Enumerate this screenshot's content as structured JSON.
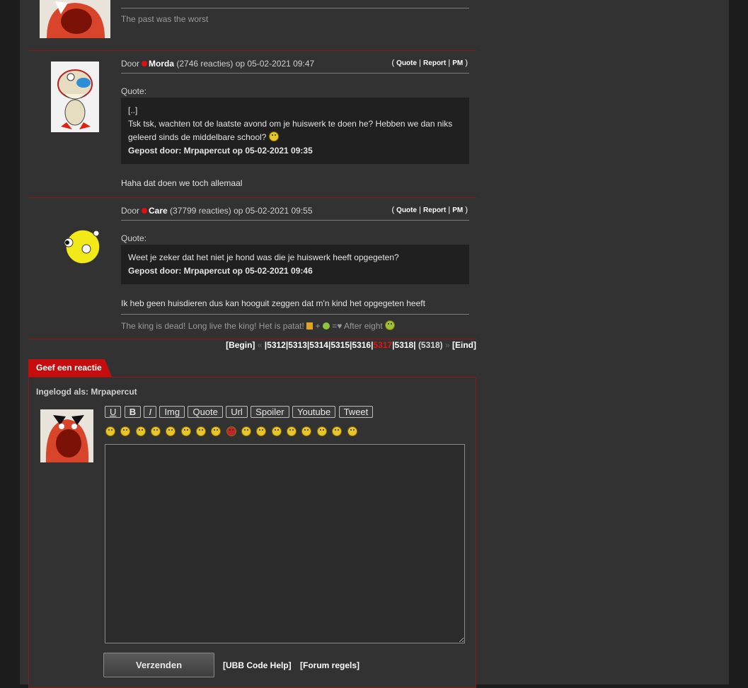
{
  "posts": [
    {
      "signature": "The past was the worst"
    },
    {
      "door": "Door",
      "author": "Morda",
      "meta": "(2746 reacties) op 05-02-2021 09:47",
      "actions": {
        "quote": "Quote",
        "report": "Report",
        "pm": "PM"
      },
      "quote_label": "Quote:",
      "quote_lines": [
        "[..]",
        "Tsk tsk, wachten tot de laatste avond om je huiswerk te doen he? Hebben we dan niks",
        "geleerd sinds de middelbare school?"
      ],
      "quote_by": "Gepost door: Mrpapercut op 05-02-2021 09:35",
      "body": "Haha dat doen we toch allemaal"
    },
    {
      "door": "Door",
      "author": "Care",
      "meta": "(37799 reacties) op 05-02-2021 09:55",
      "actions": {
        "quote": "Quote",
        "report": "Report",
        "pm": "PM"
      },
      "quote_label": "Quote:",
      "quote_lines": [
        "Weet je zeker dat het niet je hond was die je huiswerk heeft opgegeten?"
      ],
      "quote_by": "Gepost door: Mrpapercut op 05-02-2021 09:46",
      "body": "Ik heb geen huisdieren dus kan hooguit zeggen dat m'n kind het opgegeten heeft",
      "signature_a": "The king is dead! Long live the king! Het is patat!",
      "signature_b": "+",
      "signature_c": "=",
      "signature_d": "After eight"
    }
  ],
  "pager": {
    "begin": "[Begin]",
    "prev": "«",
    "pages": [
      "5312",
      "5313",
      "5314",
      "5315",
      "5316"
    ],
    "current": "5317",
    "next_page": "5318",
    "total": "(5318)",
    "next": "»",
    "end": "[Eind]"
  },
  "reply": {
    "tab": "Geef een reactie",
    "logged_in": "Ingelogd als: Mrpapercut",
    "buttons": [
      "U",
      "B",
      "I",
      "Img",
      "Quote",
      "Url",
      "Spoiler",
      "Youtube",
      "Tweet"
    ],
    "send": "Verzenden",
    "ubb_help": "[UBB Code Help]",
    "forum_rules": "[Forum regels]"
  },
  "colors": {
    "accent": "#c50d0d",
    "background": "#323232",
    "online_dot": "#e01010"
  }
}
